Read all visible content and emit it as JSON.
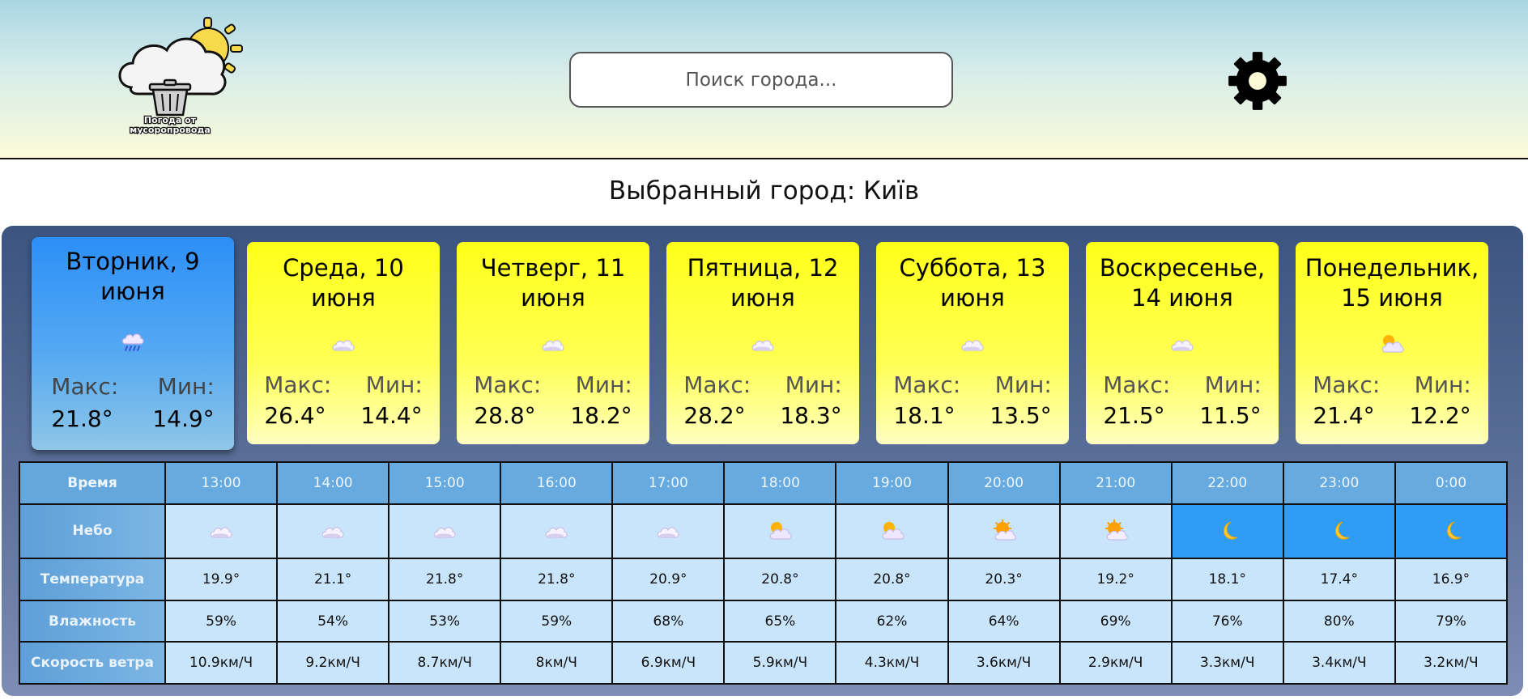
{
  "header": {
    "logo_text_line1": "Погода от",
    "logo_text_line2": "мусоропровода",
    "search_placeholder": "Поиск города...",
    "settings_icon": "gear-icon"
  },
  "city": {
    "label": "Выбранный город: Київ"
  },
  "days": [
    {
      "name": "Вторник, 9 июня",
      "icon": "rain-cloud-icon",
      "max_label": "Макс:",
      "min_label": "Мин:",
      "max": "21.8°",
      "min": "14.9°",
      "active": true
    },
    {
      "name": "Среда, 10 июня",
      "icon": "cloud-icon",
      "max_label": "Макс:",
      "min_label": "Мин:",
      "max": "26.4°",
      "min": "14.4°"
    },
    {
      "name": "Четверг, 11 июня",
      "icon": "cloud-icon",
      "max_label": "Макс:",
      "min_label": "Мин:",
      "max": "28.8°",
      "min": "18.2°"
    },
    {
      "name": "Пятница, 12 июня",
      "icon": "cloud-icon",
      "max_label": "Макс:",
      "min_label": "Мин:",
      "max": "28.2°",
      "min": "18.3°"
    },
    {
      "name": "Суббота, 13 июня",
      "icon": "cloud-icon",
      "max_label": "Макс:",
      "min_label": "Мин:",
      "max": "18.1°",
      "min": "13.5°"
    },
    {
      "name": "Воскресенье, 14 июня",
      "icon": "cloud-icon",
      "max_label": "Макс:",
      "min_label": "Мин:",
      "max": "21.5°",
      "min": "11.5°"
    },
    {
      "name": "Понедельник, 15 июня",
      "icon": "sun-cloud-icon",
      "max_label": "Макс:",
      "min_label": "Мин:",
      "max": "21.4°",
      "min": "12.2°"
    }
  ],
  "hourly": {
    "row_labels": {
      "time": "Время",
      "sky": "Небо",
      "temp": "Температура",
      "humidity": "Влажность",
      "wind": "Скорость ветра"
    },
    "hours": [
      {
        "time": "13:00",
        "sky": "cloud-icon",
        "night": false,
        "temp": "19.9°",
        "humidity": "59%",
        "wind": "10.9км/Ч"
      },
      {
        "time": "14:00",
        "sky": "cloud-icon",
        "night": false,
        "temp": "21.1°",
        "humidity": "54%",
        "wind": "9.2км/Ч"
      },
      {
        "time": "15:00",
        "sky": "cloud-icon",
        "night": false,
        "temp": "21.8°",
        "humidity": "53%",
        "wind": "8.7км/Ч"
      },
      {
        "time": "16:00",
        "sky": "cloud-icon",
        "night": false,
        "temp": "21.8°",
        "humidity": "59%",
        "wind": "8км/Ч"
      },
      {
        "time": "17:00",
        "sky": "cloud-icon",
        "night": false,
        "temp": "20.9°",
        "humidity": "68%",
        "wind": "6.9км/Ч"
      },
      {
        "time": "18:00",
        "sky": "sun-cloud-icon",
        "night": false,
        "temp": "20.8°",
        "humidity": "65%",
        "wind": "5.9км/Ч"
      },
      {
        "time": "19:00",
        "sky": "sun-cloud-icon",
        "night": false,
        "temp": "20.8°",
        "humidity": "62%",
        "wind": "4.3км/Ч"
      },
      {
        "time": "20:00",
        "sky": "sun-behind-cloud-icon",
        "night": false,
        "temp": "20.3°",
        "humidity": "64%",
        "wind": "3.6км/Ч"
      },
      {
        "time": "21:00",
        "sky": "sun-behind-cloud-icon",
        "night": false,
        "temp": "19.2°",
        "humidity": "69%",
        "wind": "2.9км/Ч"
      },
      {
        "time": "22:00",
        "sky": "moon-icon",
        "night": true,
        "temp": "18.1°",
        "humidity": "76%",
        "wind": "3.3км/Ч"
      },
      {
        "time": "23:00",
        "sky": "moon-icon",
        "night": true,
        "temp": "17.4°",
        "humidity": "80%",
        "wind": "3.4км/Ч"
      },
      {
        "time": "0:00",
        "sky": "moon-icon",
        "night": true,
        "temp": "16.9°",
        "humidity": "79%",
        "wind": "3.2км/Ч"
      }
    ]
  },
  "colors": {
    "active_day": "#2c8ff7",
    "inactive_day": "#ffff1a",
    "night_cell": "#2f9cf6",
    "table_cell": "#c9e5fb",
    "panel": "#3c5480"
  }
}
